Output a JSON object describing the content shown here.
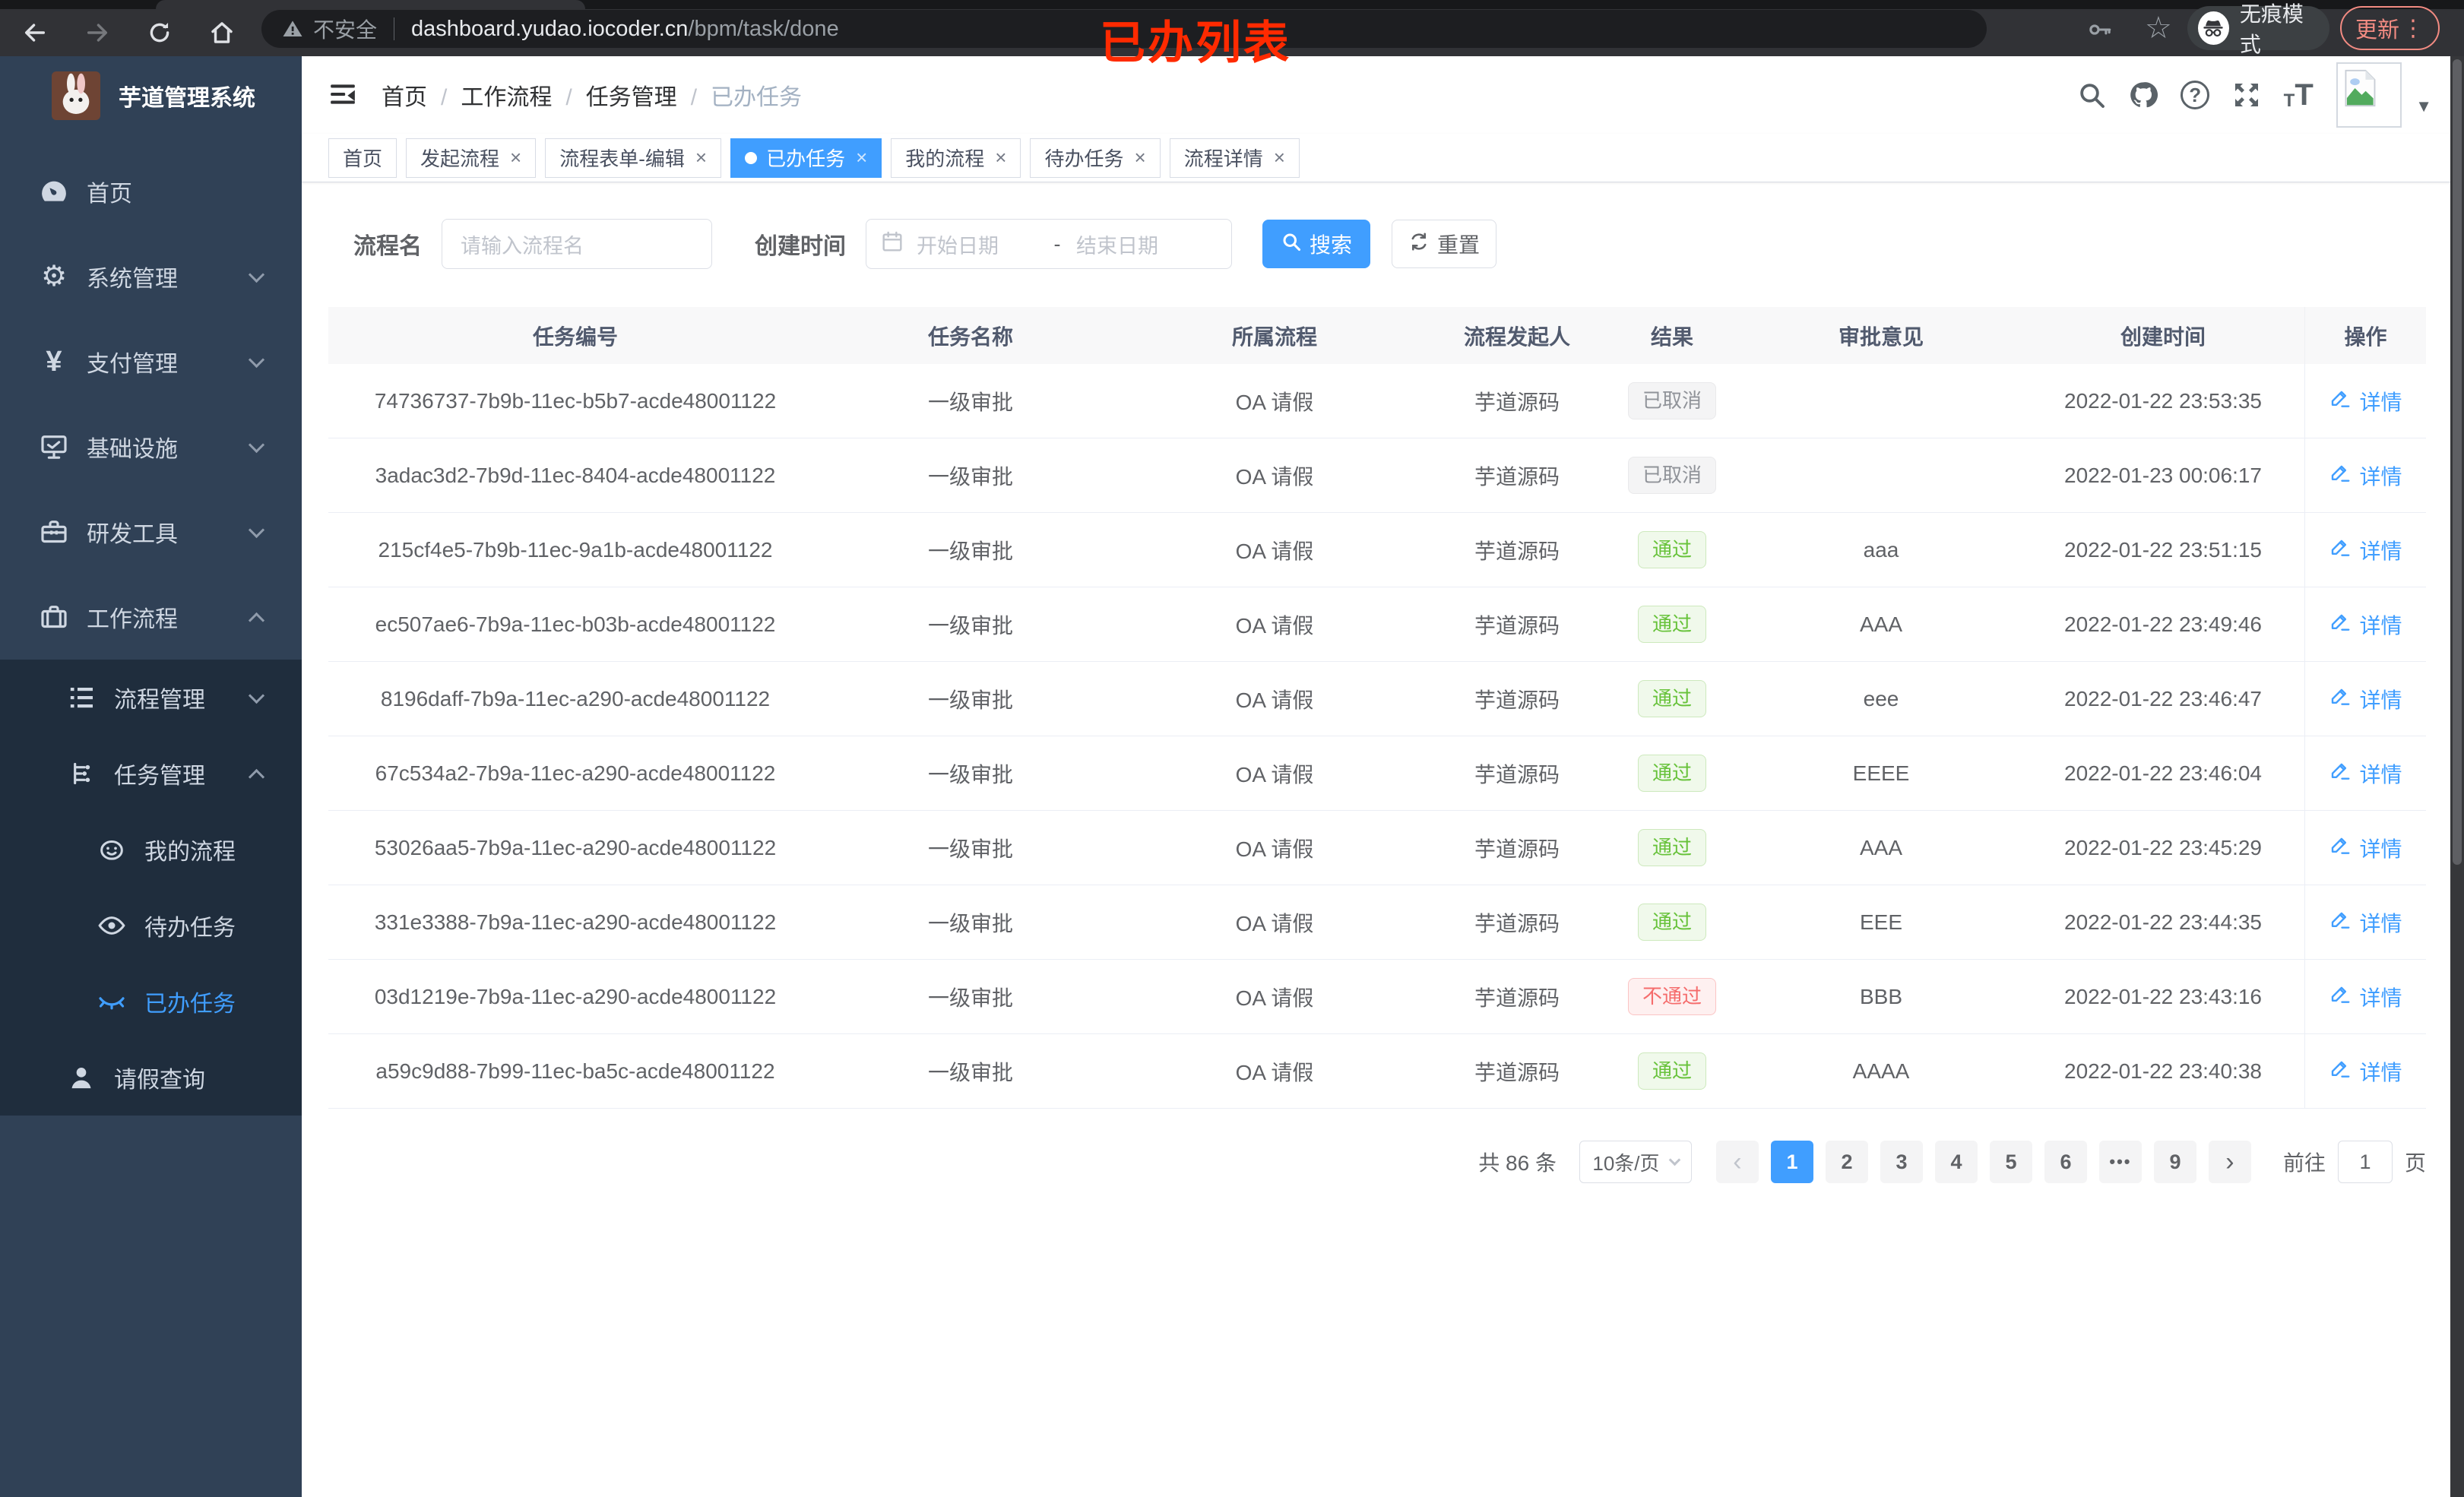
{
  "colors": {
    "accent_blue": "#409eff",
    "success_green": "#67c23a",
    "danger_red": "#f56c6c",
    "info_gray": "#909399",
    "annotation_red": "#ff2a00",
    "update_salmon": "#f28b82",
    "sidebar_bg": "#304156",
    "submenu_bg": "#1f2d3d"
  },
  "annotation": {
    "text": "已办列表"
  },
  "browser": {
    "security_text": "不安全",
    "url_host": "dashboard.yudao.iocoder.cn",
    "url_path": "/bpm/task/done",
    "incognito_label": "无痕模式",
    "update_label": "更新",
    "menu_dots": "⋮",
    "star_glyph": "☆"
  },
  "sidebar": {
    "title": "芋道管理系统",
    "items": [
      {
        "icon": "dashboard-icon",
        "label": "首页",
        "level": 1
      },
      {
        "icon": "gear-icon",
        "label": "系统管理",
        "level": 1,
        "chevron": "down"
      },
      {
        "icon": "yen-icon",
        "label": "支付管理",
        "level": 1,
        "chevron": "down"
      },
      {
        "icon": "monitor-icon",
        "label": "基础设施",
        "level": 1,
        "chevron": "down"
      },
      {
        "icon": "toolbox-icon",
        "label": "研发工具",
        "level": 1,
        "chevron": "down"
      },
      {
        "icon": "briefcase-icon",
        "label": "工作流程",
        "level": 1,
        "chevron": "up"
      },
      {
        "icon": "list-tree-icon",
        "label": "流程管理",
        "level": 2,
        "chevron": "down",
        "dark": true
      },
      {
        "icon": "tree-icon",
        "label": "任务管理",
        "level": 2,
        "chevron": "up",
        "dark": true
      },
      {
        "icon": "face-icon",
        "label": "我的流程",
        "level": 3,
        "dark": true
      },
      {
        "icon": "eye-icon",
        "label": "待办任务",
        "level": 3,
        "dark": true
      },
      {
        "icon": "eye-closed-icon",
        "label": "已办任务",
        "level": 3,
        "dark": true,
        "active": true
      },
      {
        "icon": "user-icon",
        "label": "请假查询",
        "level": 2,
        "dark": true
      }
    ]
  },
  "header": {
    "breadcrumb": [
      {
        "label": "首页"
      },
      {
        "label": "工作流程"
      },
      {
        "label": "任务管理"
      },
      {
        "label": "已办任务"
      }
    ]
  },
  "tabs": [
    {
      "label": "首页"
    },
    {
      "label": "发起流程",
      "closable": true
    },
    {
      "label": "流程表单-编辑",
      "closable": true
    },
    {
      "label": "已办任务",
      "closable": true,
      "active": true
    },
    {
      "label": "我的流程",
      "closable": true
    },
    {
      "label": "待办任务",
      "closable": true
    },
    {
      "label": "流程详情",
      "closable": true
    }
  ],
  "filters": {
    "name_label": "流程名",
    "name_placeholder": "请输入流程名",
    "created_label": "创建时间",
    "start_placeholder": "开始日期",
    "range_separator": "-",
    "end_placeholder": "结束日期",
    "search_label": "搜索",
    "reset_label": "重置"
  },
  "table": {
    "headers": [
      "任务编号",
      "任务名称",
      "所属流程",
      "流程发起人",
      "结果",
      "审批意见",
      "创建时间",
      "操作"
    ],
    "action_label": "详情",
    "rows": [
      {
        "id": "74736737-7b9b-11ec-b5b7-acde48001122",
        "name": "一级审批",
        "process": "OA 请假",
        "starter": "芋道源码",
        "result": {
          "label": "已取消",
          "type": "info"
        },
        "opinion": "",
        "created": "2022-01-22 23:53:35",
        "action": "详情"
      },
      {
        "id": "3adac3d2-7b9d-11ec-8404-acde48001122",
        "name": "一级审批",
        "process": "OA 请假",
        "starter": "芋道源码",
        "result": {
          "label": "已取消",
          "type": "info"
        },
        "opinion": "",
        "created": "2022-01-23 00:06:17",
        "action": "详情"
      },
      {
        "id": "215cf4e5-7b9b-11ec-9a1b-acde48001122",
        "name": "一级审批",
        "process": "OA 请假",
        "starter": "芋道源码",
        "result": {
          "label": "通过",
          "type": "success"
        },
        "opinion": "aaa",
        "created": "2022-01-22 23:51:15",
        "action": "详情"
      },
      {
        "id": "ec507ae6-7b9a-11ec-b03b-acde48001122",
        "name": "一级审批",
        "process": "OA 请假",
        "starter": "芋道源码",
        "result": {
          "label": "通过",
          "type": "success"
        },
        "opinion": "AAA",
        "created": "2022-01-22 23:49:46",
        "action": "详情"
      },
      {
        "id": "8196daff-7b9a-11ec-a290-acde48001122",
        "name": "一级审批",
        "process": "OA 请假",
        "starter": "芋道源码",
        "result": {
          "label": "通过",
          "type": "success"
        },
        "opinion": "eee",
        "created": "2022-01-22 23:46:47",
        "action": "详情"
      },
      {
        "id": "67c534a2-7b9a-11ec-a290-acde48001122",
        "name": "一级审批",
        "process": "OA 请假",
        "starter": "芋道源码",
        "result": {
          "label": "通过",
          "type": "success"
        },
        "opinion": "EEEE",
        "created": "2022-01-22 23:46:04",
        "action": "详情"
      },
      {
        "id": "53026aa5-7b9a-11ec-a290-acde48001122",
        "name": "一级审批",
        "process": "OA 请假",
        "starter": "芋道源码",
        "result": {
          "label": "通过",
          "type": "success"
        },
        "opinion": "AAA",
        "created": "2022-01-22 23:45:29",
        "action": "详情"
      },
      {
        "id": "331e3388-7b9a-11ec-a290-acde48001122",
        "name": "一级审批",
        "process": "OA 请假",
        "starter": "芋道源码",
        "result": {
          "label": "通过",
          "type": "success"
        },
        "opinion": "EEE",
        "created": "2022-01-22 23:44:35",
        "action": "详情"
      },
      {
        "id": "03d1219e-7b9a-11ec-a290-acde48001122",
        "name": "一级审批",
        "process": "OA 请假",
        "starter": "芋道源码",
        "result": {
          "label": "不通过",
          "type": "danger"
        },
        "opinion": "BBB",
        "created": "2022-01-22 23:43:16",
        "action": "详情"
      },
      {
        "id": "a59c9d88-7b99-11ec-ba5c-acde48001122",
        "name": "一级审批",
        "process": "OA 请假",
        "starter": "芋道源码",
        "result": {
          "label": "通过",
          "type": "success"
        },
        "opinion": "AAAA",
        "created": "2022-01-22 23:40:38",
        "action": "详情"
      }
    ]
  },
  "pagination": {
    "total_label": "共 86 条",
    "per_page_label": "10条/页",
    "prev_glyph": "‹",
    "next_glyph": "›",
    "pages": [
      {
        "label": "1",
        "active": true
      },
      {
        "label": "2"
      },
      {
        "label": "3"
      },
      {
        "label": "4"
      },
      {
        "label": "5"
      },
      {
        "label": "6"
      },
      {
        "label": "•••",
        "ellipsis": true
      },
      {
        "label": "9"
      }
    ],
    "goto_label": "前往",
    "goto_value": "1",
    "page_unit": "页"
  }
}
